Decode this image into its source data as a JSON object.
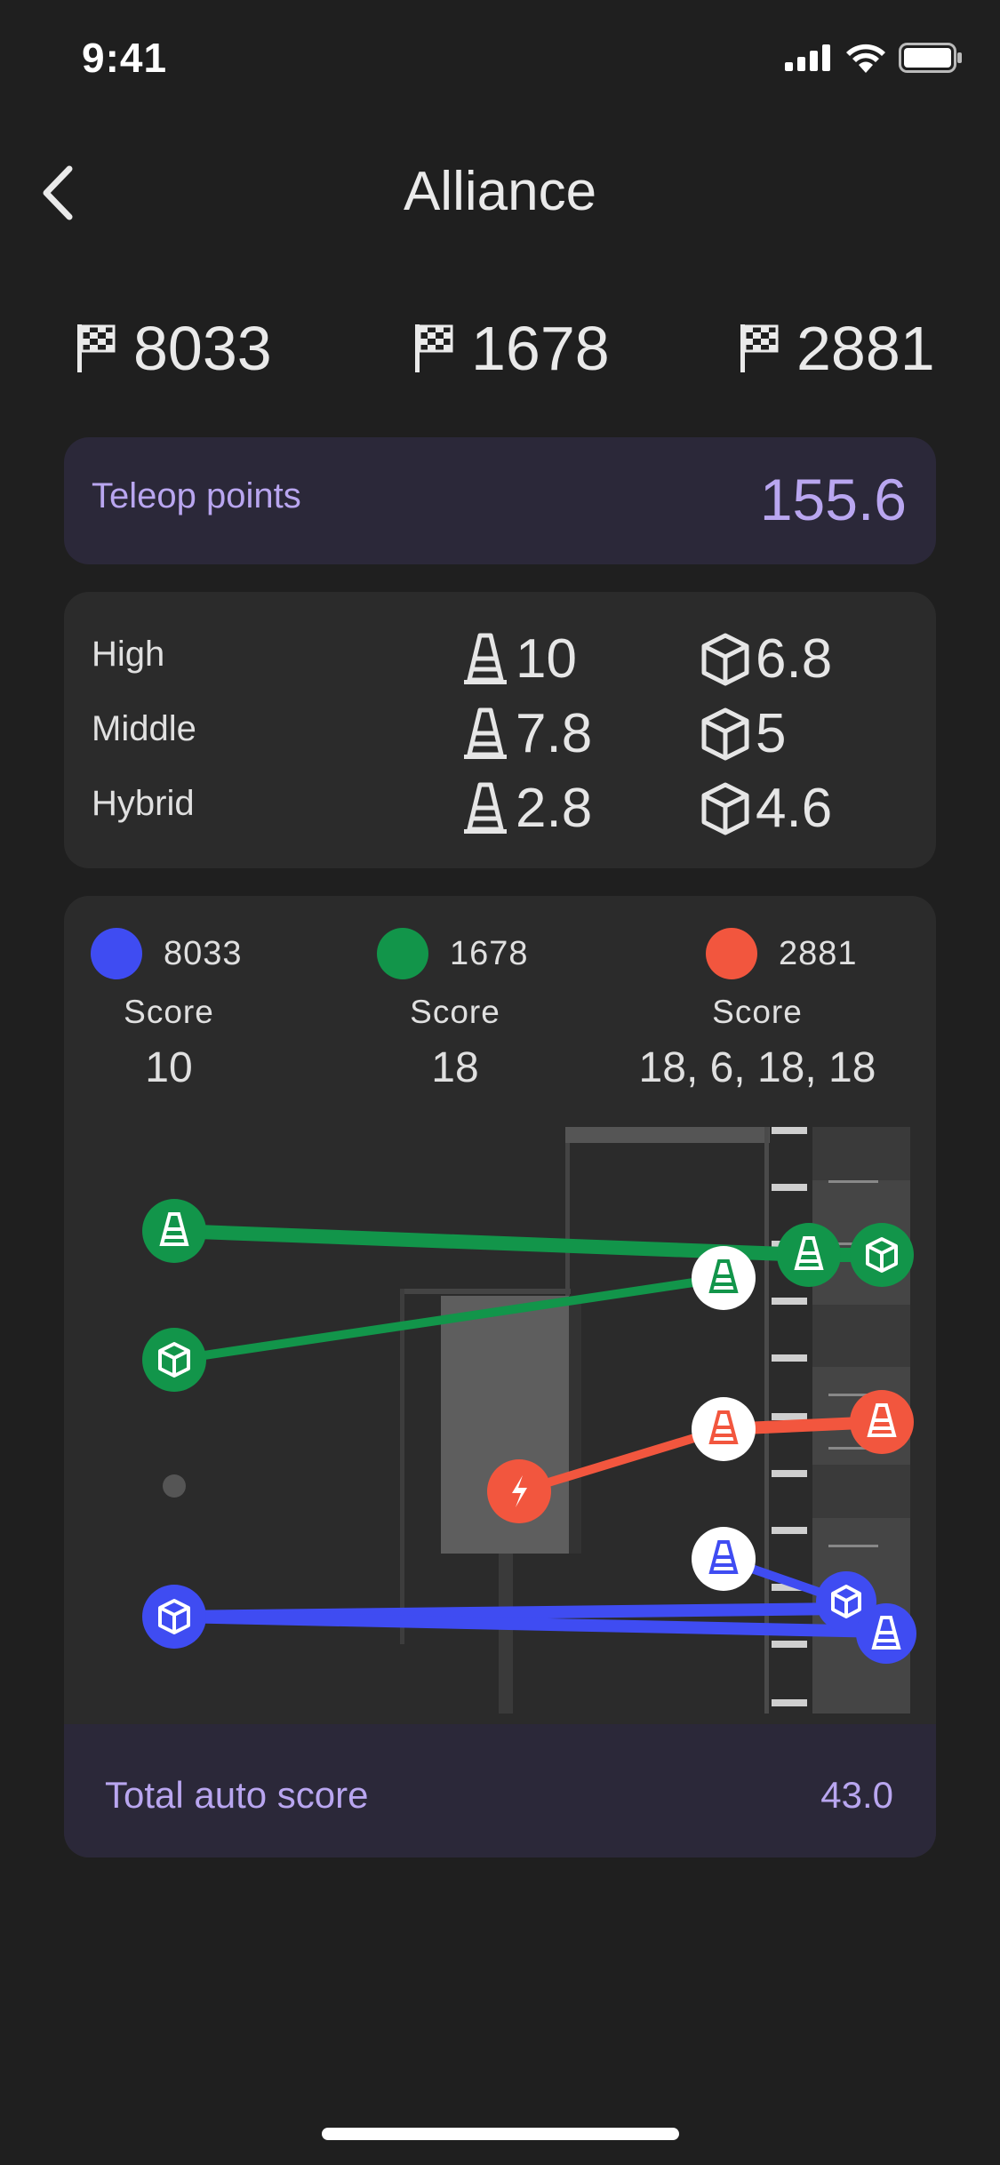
{
  "status": {
    "time": "9:41"
  },
  "header": {
    "title": "Alliance"
  },
  "teams": [
    "8033",
    "1678",
    "2881"
  ],
  "teleop": {
    "label": "Teleop points",
    "value": "155.6"
  },
  "levels": [
    {
      "label": "High",
      "cone": "10",
      "cube": "6.8"
    },
    {
      "label": "Middle",
      "cone": "7.8",
      "cube": "5"
    },
    {
      "label": "Hybrid",
      "cone": "2.8",
      "cube": "4.6"
    }
  ],
  "auto": {
    "legend": [
      {
        "team": "8033",
        "color": "#3f4cf2",
        "score_label": "Score",
        "score": "10"
      },
      {
        "team": "1678",
        "color": "#12954a",
        "score_label": "Score",
        "score": "18"
      },
      {
        "team": "2881",
        "color": "#f2563e",
        "score_label": "Score",
        "score": "18, 6, 18, 18"
      }
    ],
    "total_label": "Total auto score",
    "total_value": "43.0"
  },
  "colors": {
    "accent": "#b9a6f0",
    "blue": "#3f4cf2",
    "green": "#12954a",
    "red": "#f2563e"
  }
}
